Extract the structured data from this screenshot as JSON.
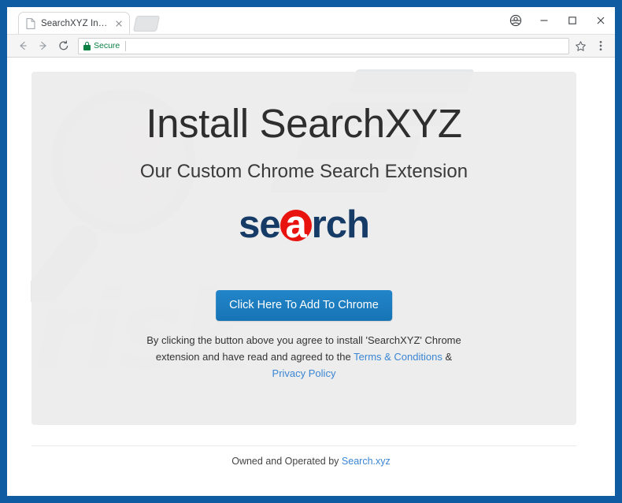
{
  "window": {
    "controls": {
      "profile": "profile-account",
      "minimize": "–",
      "maximize": "□",
      "close": "✕"
    }
  },
  "tabstrip": {
    "tabs": [
      {
        "title": "SearchXYZ Install",
        "close_label": "✕",
        "favicon": "page-icon"
      }
    ],
    "new_tab_label": "+"
  },
  "toolbar": {
    "back_label": "←",
    "forward_label": "→",
    "reload_label": "⟳",
    "secure_label": "Secure",
    "url_value": "",
    "url_placeholder": "",
    "bookmark_icon": "star-icon",
    "menu_icon": "three-dot-menu-icon",
    "colors": {
      "secure_green": "#0b8043",
      "toolbar_bg": "#f5f5f5"
    }
  },
  "page": {
    "heading": "Install SearchXYZ",
    "subheading": "Our Custom Chrome Search Extension",
    "logo": {
      "part1": "se",
      "accent_letter": "a",
      "part2": "rch",
      "text_color": "#153b66",
      "accent_circle_color": "#e8130f"
    },
    "cta_button": {
      "label": "Click Here To Add To Chrome",
      "color": "#1a7ac0"
    },
    "disclaimer": {
      "line1_before": "By clicking the button above you agree to install 'SearchXYZ' Chrome",
      "line2_before": "extension and have read and agreed to the ",
      "terms_link": "Terms & Conditions",
      "line2_after": " &",
      "privacy_link": "Privacy Policy",
      "link_color": "#3a86d4"
    },
    "footer": {
      "text": "Owned and Operated by ",
      "link": "Search.xyz"
    },
    "watermark": {
      "text": "risk",
      "magnifier": "magnifier-watermark",
      "pc_logo": "pc-logo-watermark"
    }
  },
  "frame": {
    "border_color": "#0f5ca3"
  }
}
